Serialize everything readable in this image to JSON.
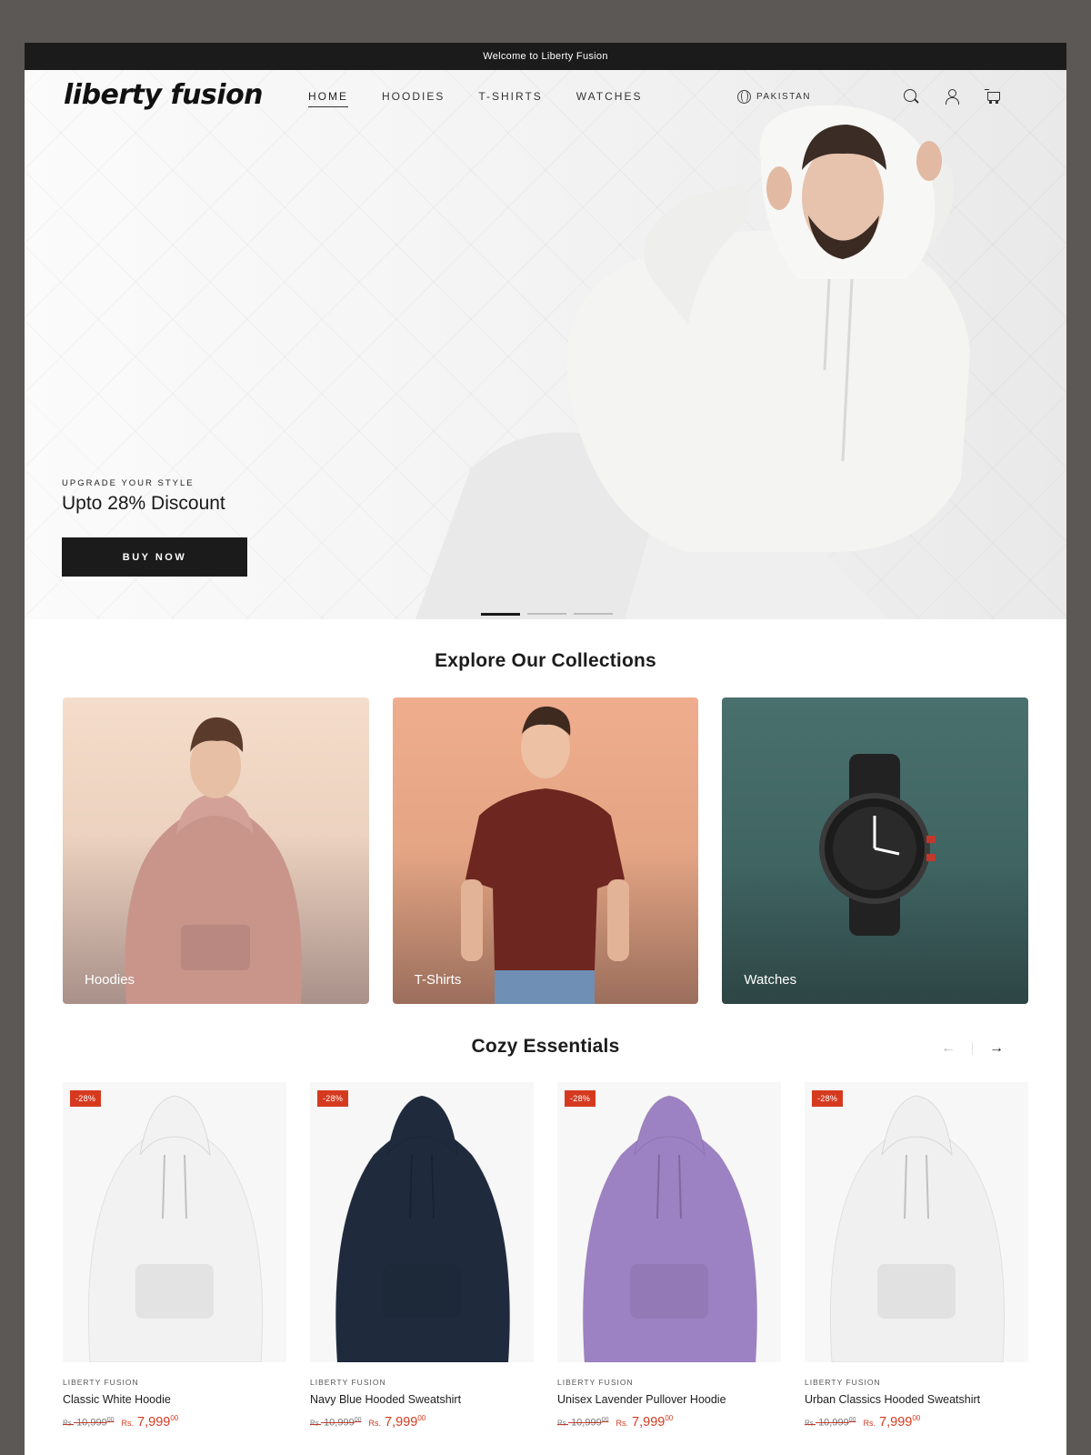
{
  "announcement": "Welcome to Liberty Fusion",
  "header": {
    "logo": "liberty fusion",
    "nav": [
      "HOME",
      "HOODIES",
      "T-SHIRTS",
      "WATCHES"
    ],
    "active_nav": "HOME",
    "country": "PAKISTAN",
    "icons": [
      "search-icon",
      "account-icon",
      "cart-icon"
    ]
  },
  "hero": {
    "kicker": "UPGRADE YOUR STYLE",
    "title": "Upto 28% Discount",
    "button": "BUY NOW",
    "slides": 3,
    "active_slide": 1
  },
  "collections": {
    "title": "Explore Our Collections",
    "items": [
      {
        "label": "Hoodies"
      },
      {
        "label": "T-Shirts"
      },
      {
        "label": "Watches"
      }
    ]
  },
  "cozy": {
    "title": "Cozy Essentials",
    "prev": "←",
    "next": "→",
    "products": [
      {
        "badge": "-28%",
        "vendor": "LIBERTY FUSION",
        "name": "Classic White Hoodie",
        "compare_cur": "Rs.",
        "compare": "10,999",
        "compare_dec": "00",
        "sale_cur": "Rs.",
        "sale": "7,999",
        "sale_dec": "00",
        "color": "#f2f2f2"
      },
      {
        "badge": "-28%",
        "vendor": "LIBERTY FUSION",
        "name": "Navy Blue Hooded Sweatshirt",
        "compare_cur": "Rs.",
        "compare": "10,999",
        "compare_dec": "00",
        "sale_cur": "Rs.",
        "sale": "7,999",
        "sale_dec": "00",
        "color": "#1f2b3d"
      },
      {
        "badge": "-28%",
        "vendor": "LIBERTY FUSION",
        "name": "Unisex Lavender Pullover Hoodie",
        "compare_cur": "Rs.",
        "compare": "10,999",
        "compare_dec": "00",
        "sale_cur": "Rs.",
        "sale": "7,999",
        "sale_dec": "00",
        "color": "#9d82c3"
      },
      {
        "badge": "-28%",
        "vendor": "LIBERTY FUSION",
        "name": "Urban Classics Hooded Sweatshirt",
        "compare_cur": "Rs.",
        "compare": "10,999",
        "compare_dec": "00",
        "sale_cur": "Rs.",
        "sale": "7,999",
        "sale_dec": "00",
        "color": "#f0f0f0"
      }
    ]
  }
}
